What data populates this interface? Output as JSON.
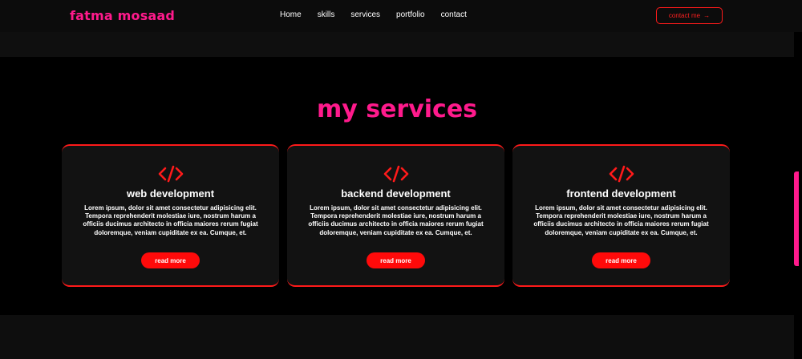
{
  "navbar": {
    "logo": "fatma mosaad",
    "links": [
      "Home",
      "skills",
      "services",
      "portfolio",
      "contact"
    ],
    "contact_label": "contact me",
    "contact_arrow": "→"
  },
  "services": {
    "title": "my services",
    "cards": [
      {
        "icon": "code-icon",
        "title": "web development",
        "text": "Lorem ipsum, dolor sit amet consectetur adipisicing elit. Tempora reprehenderit molestiae iure, nostrum harum a officiis ducimus architecto in officia maiores rerum fugiat doloremque, veniam cupiditate ex ea. Cumque, et.",
        "button": "read more"
      },
      {
        "icon": "code-icon",
        "title": "backend development",
        "text": "Lorem ipsum, dolor sit amet consectetur adipisicing elit. Tempora reprehenderit molestiae iure, nostrum harum a officiis ducimus architecto in officia maiores rerum fugiat doloremque, veniam cupiditate ex ea. Cumque, et.",
        "button": "read more"
      },
      {
        "icon": "code-icon",
        "title": "frontend development",
        "text": "Lorem ipsum, dolor sit amet consectetur adipisicing elit. Tempora reprehenderit molestiae iure, nostrum harum a officiis ducimus architecto in officia maiores rerum fugiat doloremque, veniam cupiditate ex ea. Cumque, et.",
        "button": "read more"
      }
    ]
  },
  "colors": {
    "accent_pink": "#ff1a8c",
    "accent_red": "#ff1a1a",
    "background": "#000000",
    "card": "#121212"
  }
}
